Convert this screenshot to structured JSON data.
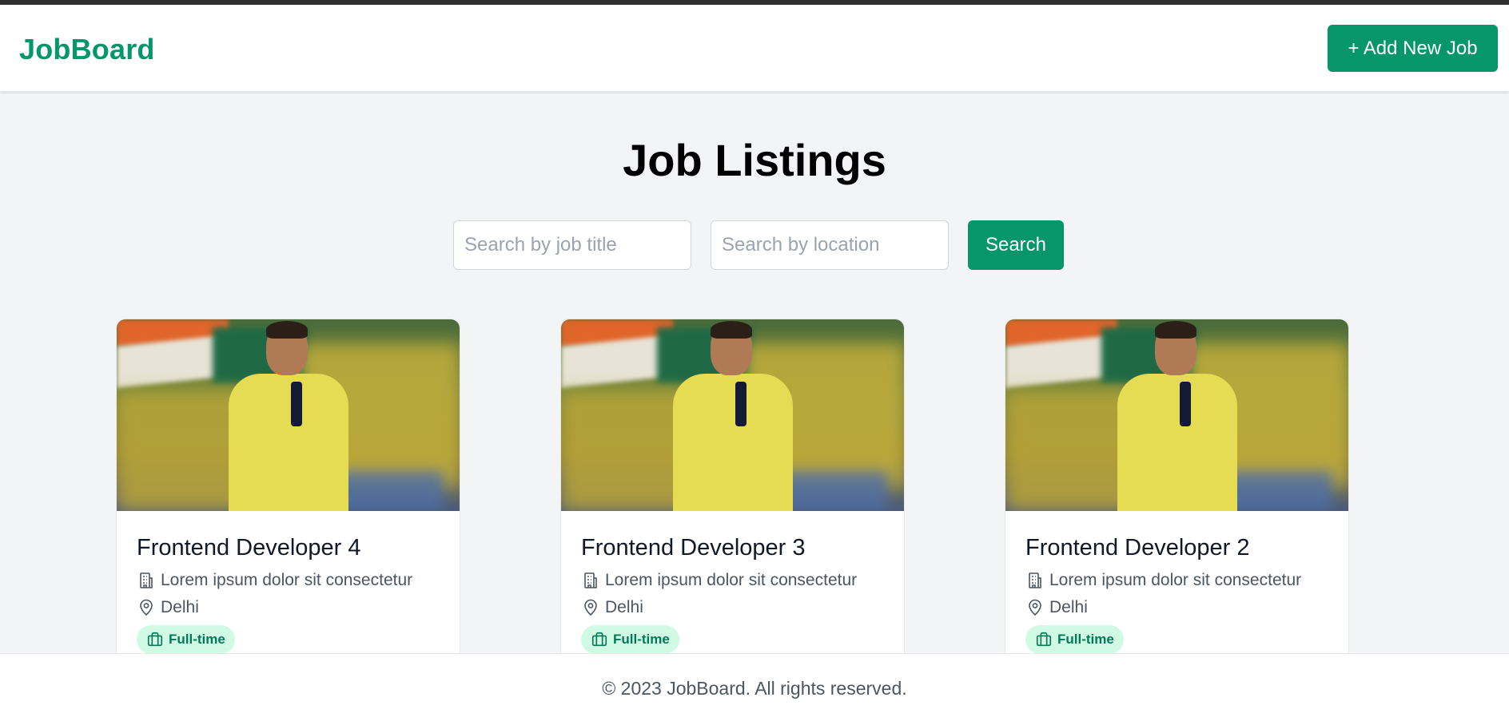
{
  "header": {
    "brand": "JobBoard",
    "add_button_label": "+ Add New Job"
  },
  "main": {
    "title": "Job Listings",
    "search": {
      "title_placeholder": "Search by job title",
      "location_placeholder": "Search by location",
      "button_label": "Search"
    },
    "jobs": [
      {
        "title": "Frontend Developer 4",
        "company": "Lorem ipsum dolor sit consectetur",
        "location": "Delhi",
        "type": "Full-time"
      },
      {
        "title": "Frontend Developer 3",
        "company": "Lorem ipsum dolor sit consectetur",
        "location": "Delhi",
        "type": "Full-time"
      },
      {
        "title": "Frontend Developer 2",
        "company": "Lorem ipsum dolor sit consectetur",
        "location": "Delhi",
        "type": "Full-time"
      }
    ]
  },
  "footer": {
    "copyright": "© 2023 JobBoard. All rights reserved."
  },
  "icons": {
    "company": "building-icon",
    "location": "map-pin-icon",
    "job_type": "briefcase-icon"
  },
  "colors": {
    "accent": "#059669",
    "badge_bg": "#d1fae5",
    "badge_text": "#047857",
    "page_bg": "#f3f4f6"
  }
}
